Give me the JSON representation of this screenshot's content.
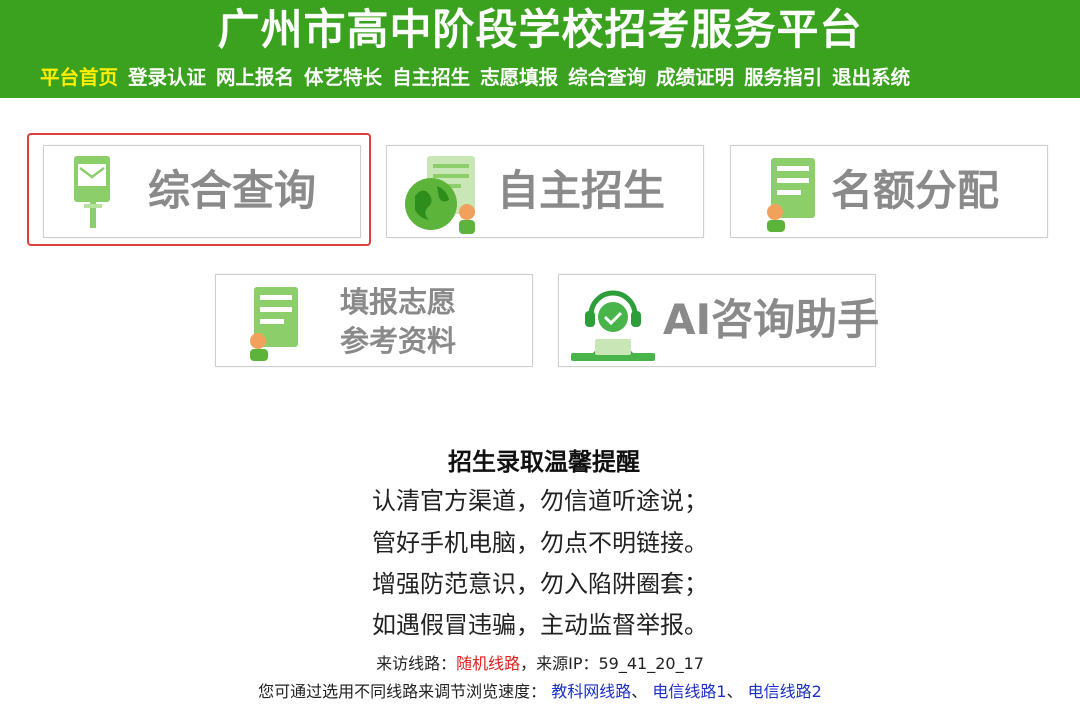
{
  "header": {
    "title": "广州市高中阶段学校招考服务平台",
    "nav": [
      {
        "label": "平台首页",
        "active": true
      },
      {
        "label": "登录认证"
      },
      {
        "label": "网上报名"
      },
      {
        "label": "体艺特长"
      },
      {
        "label": "自主招生"
      },
      {
        "label": "志愿填报"
      },
      {
        "label": "综合查询"
      },
      {
        "label": "成绩证明"
      },
      {
        "label": "服务指引"
      },
      {
        "label": "退出系统"
      }
    ],
    "colors": {
      "bar": "#3aa21e",
      "active_nav": "#ffee00"
    }
  },
  "tiles": {
    "zonghe": {
      "label": "综合查询",
      "icon": "mailbox-icon",
      "selected": true
    },
    "zizhu": {
      "label": "自主招生",
      "icon": "globe-document-icon"
    },
    "minge": {
      "label": "名额分配",
      "icon": "certificate-icon"
    },
    "tianbao": {
      "line1": "填报志愿",
      "line2": "参考资料",
      "icon": "document-person-icon"
    },
    "ai": {
      "label": "AI咨询助手",
      "icon": "assistant-headset-icon"
    }
  },
  "notice": {
    "title": "招生录取温馨提醒",
    "lines": [
      "认清官方渠道，勿信道听途说；",
      "管好手机电脑，勿点不明链接。",
      "增强防范意识，勿入陷阱圈套；",
      "如遇假冒违骗，主动监督举报。"
    ]
  },
  "route": {
    "visit_prefix": "来访线路：",
    "visit_route": "随机线路",
    "source_prefix": "，来源IP：",
    "source_ip": "59_41_20_17",
    "hint": "您可通过选用不同线路来调节浏览速度：",
    "links": [
      "教科网线路",
      "电信线路1",
      "电信线路2"
    ],
    "sep1": "、",
    "sep2": "、"
  }
}
